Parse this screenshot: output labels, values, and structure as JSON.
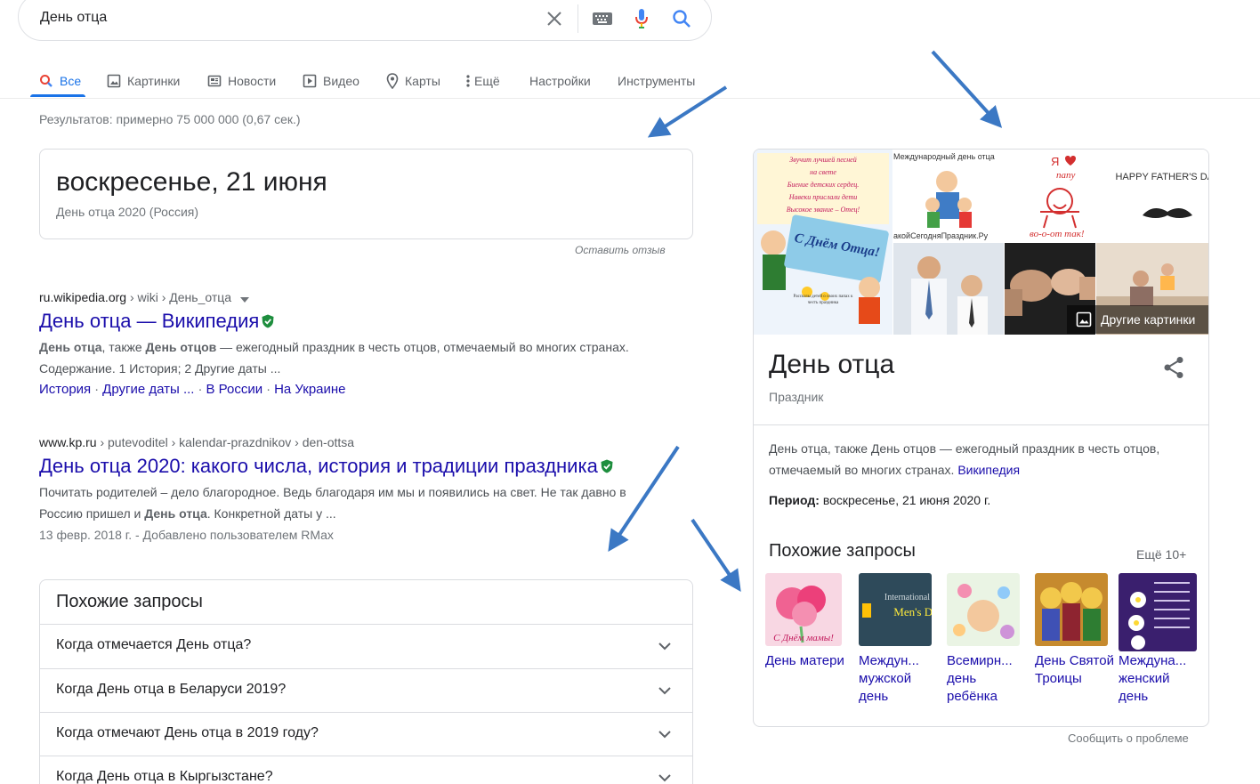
{
  "search": {
    "query": "День отца"
  },
  "tabs": [
    {
      "label": "Все",
      "icon": "search-icon",
      "active": true
    },
    {
      "label": "Картинки",
      "icon": "image-icon"
    },
    {
      "label": "Новости",
      "icon": "news-icon"
    },
    {
      "label": "Видео",
      "icon": "video-icon"
    },
    {
      "label": "Карты",
      "icon": "map-pin-icon"
    },
    {
      "label": "Ещё",
      "icon": "more-vert-icon"
    },
    {
      "label": "Настройки"
    },
    {
      "label": "Инструменты"
    }
  ],
  "results_stats": "Результатов: примерно 75 000 000 (0,67 сек.)",
  "answer": {
    "main": "воскресенье, 21 июня",
    "sub": "День отца 2020 (Россия)",
    "feedback": "Оставить отзыв"
  },
  "results": [
    {
      "domain": "ru.wikipedia.org",
      "path": " › wiki › День_отца",
      "title": "День отца — Википедия",
      "snippet_parts": [
        "День отца",
        ", также ",
        "День отцов",
        " — ежегодный праздник в честь отцов, отмечаемый во многих странах. Содержание. 1 История; 2 Другие даты ..."
      ],
      "sitelinks": [
        "История",
        "Другие даты ...",
        "В России",
        "На Украине"
      ]
    },
    {
      "domain": "www.kp.ru",
      "path": " › putevoditel › kalendar-prazdnikov › den-ottsa",
      "title": "День отца 2020: какого числа, история и традиции праздника",
      "snippet_parts": [
        "Почитать родителей – дело благородное. Ведь благодаря им мы и появились на свет. Не так давно в Россию пришел и ",
        "День отца",
        ". Конкретной даты у ..."
      ],
      "meta": "13 февр. 2018 г. - Добавлено пользователем RMax"
    }
  ],
  "related_questions": {
    "heading": "Похожие запросы",
    "items": [
      "Когда отмечается День отца?",
      "Когда День отца в Беларуси 2019?",
      "Когда отмечают День отца в 2019 году?",
      "Когда День отца в Кыргызстане?"
    ]
  },
  "knowledge_panel": {
    "images": {
      "poem_lines": [
        "Звучит лучшей песней",
        "на свете",
        "Биение детских сердец.",
        "Навеки прислали дети",
        "Высокое звание – Отец!"
      ],
      "card_text": "С Днём Отца!",
      "caption": "Рассказы детей о своих папах к",
      "caption2": "честь праздника",
      "intl_label": "Международный день отца",
      "site_label": "акойСегодняПраздник.Ру",
      "papa_top": "Я",
      "papa_word": "папу",
      "papa_bottom": "во-о-от так!",
      "happy_fathers": "HAPPY FATHER'S DAY",
      "more_images": "Другие картинки"
    },
    "title": "День отца",
    "subtitle": "Праздник",
    "description": "День отца, также День отцов — ежегодный праздник в честь отцов, отмечаемый во многих странах.",
    "source_link": "Википедия",
    "period_label": "Период:",
    "period_value": "воскресенье, 21 июня 2020 г.",
    "related_title": "Похожие запросы",
    "related_more": "Ещё 10+",
    "related": [
      {
        "label": "День матери",
        "thumb_text": "С Днём мамы!"
      },
      {
        "label": "Междун... мужской день",
        "thumb_text": "Men's DAY"
      },
      {
        "label": "Всемирн... день ребёнка"
      },
      {
        "label": "День Святой Троицы"
      },
      {
        "label": "Междуна... женский день"
      }
    ]
  },
  "report": "Сообщить о проблеме",
  "colors": {
    "link": "#1a0dab",
    "accent": "#1a73e8",
    "arrow": "#3b78c4"
  }
}
